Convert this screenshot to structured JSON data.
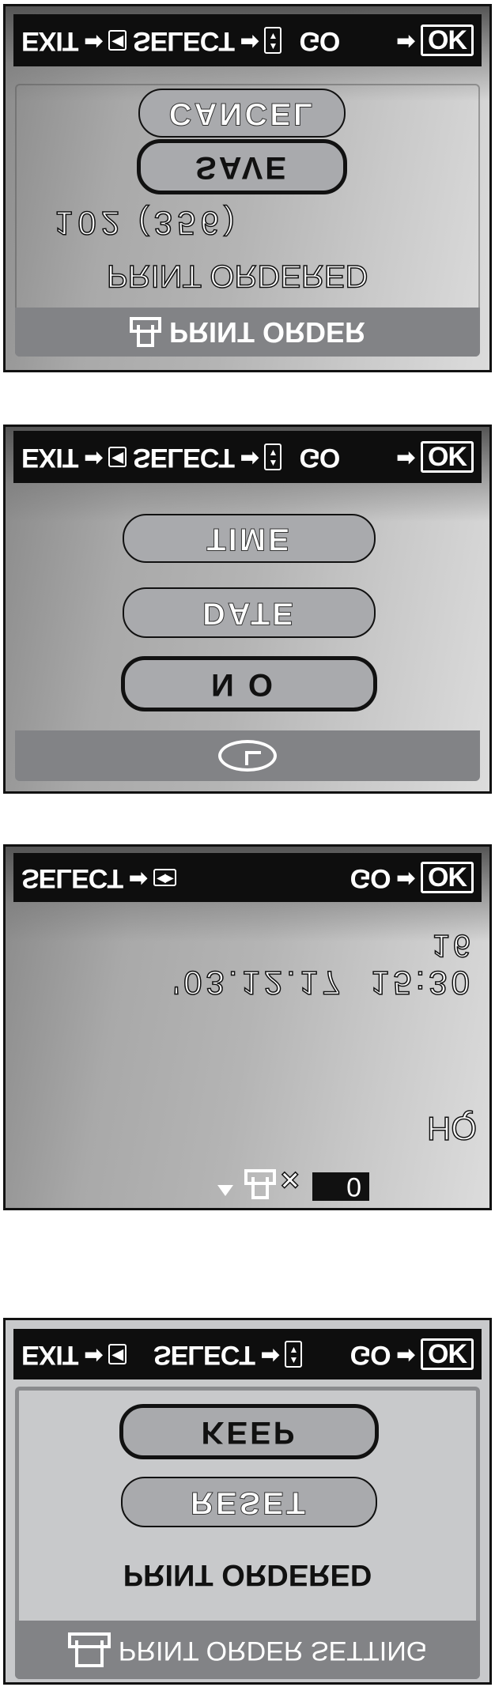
{
  "header": {
    "exit": "EXIT",
    "select": "SELECT",
    "go": "GO",
    "ok": "OK",
    "arrow": "➡",
    "left_key": "◀",
    "updown_key": "▲▼",
    "leftright_key": "◀▶"
  },
  "screens": [
    {
      "name": "print-order",
      "buttons": [
        {
          "label": "CANCEL",
          "selected": false
        },
        {
          "label": "SAVE",
          "selected": true
        }
      ],
      "count": "102 (356)",
      "status": "PRINT ORDERED",
      "footer": "PRINT ORDER",
      "footer_icon": "printer-icon"
    },
    {
      "name": "date-time",
      "buttons": [
        {
          "label": "TIME",
          "selected": false
        },
        {
          "label": "DATE",
          "selected": false
        },
        {
          "label": "NO",
          "selected": true
        }
      ],
      "footer_icon": "clock-icon"
    },
    {
      "name": "playback",
      "frame": "16",
      "datetime": "'03.12.17  15:30",
      "quality": "HQ",
      "print_mult": "×",
      "print_count": "0",
      "icons": [
        "down-triangle-icon",
        "printer-icon"
      ]
    },
    {
      "name": "print-order-setting",
      "buttons": [
        {
          "label": "KEEP",
          "selected": true
        },
        {
          "label": "RESET",
          "selected": false
        }
      ],
      "status": "PRINT ORDERED",
      "footer": "PRINT ORDER SETTING",
      "footer_icon": "printer-icon"
    }
  ],
  "colors": {
    "bar": "#0e0e0e",
    "pill": "#a9aaad",
    "footer": "#828386",
    "menu_bg": "#c8c9cb"
  }
}
